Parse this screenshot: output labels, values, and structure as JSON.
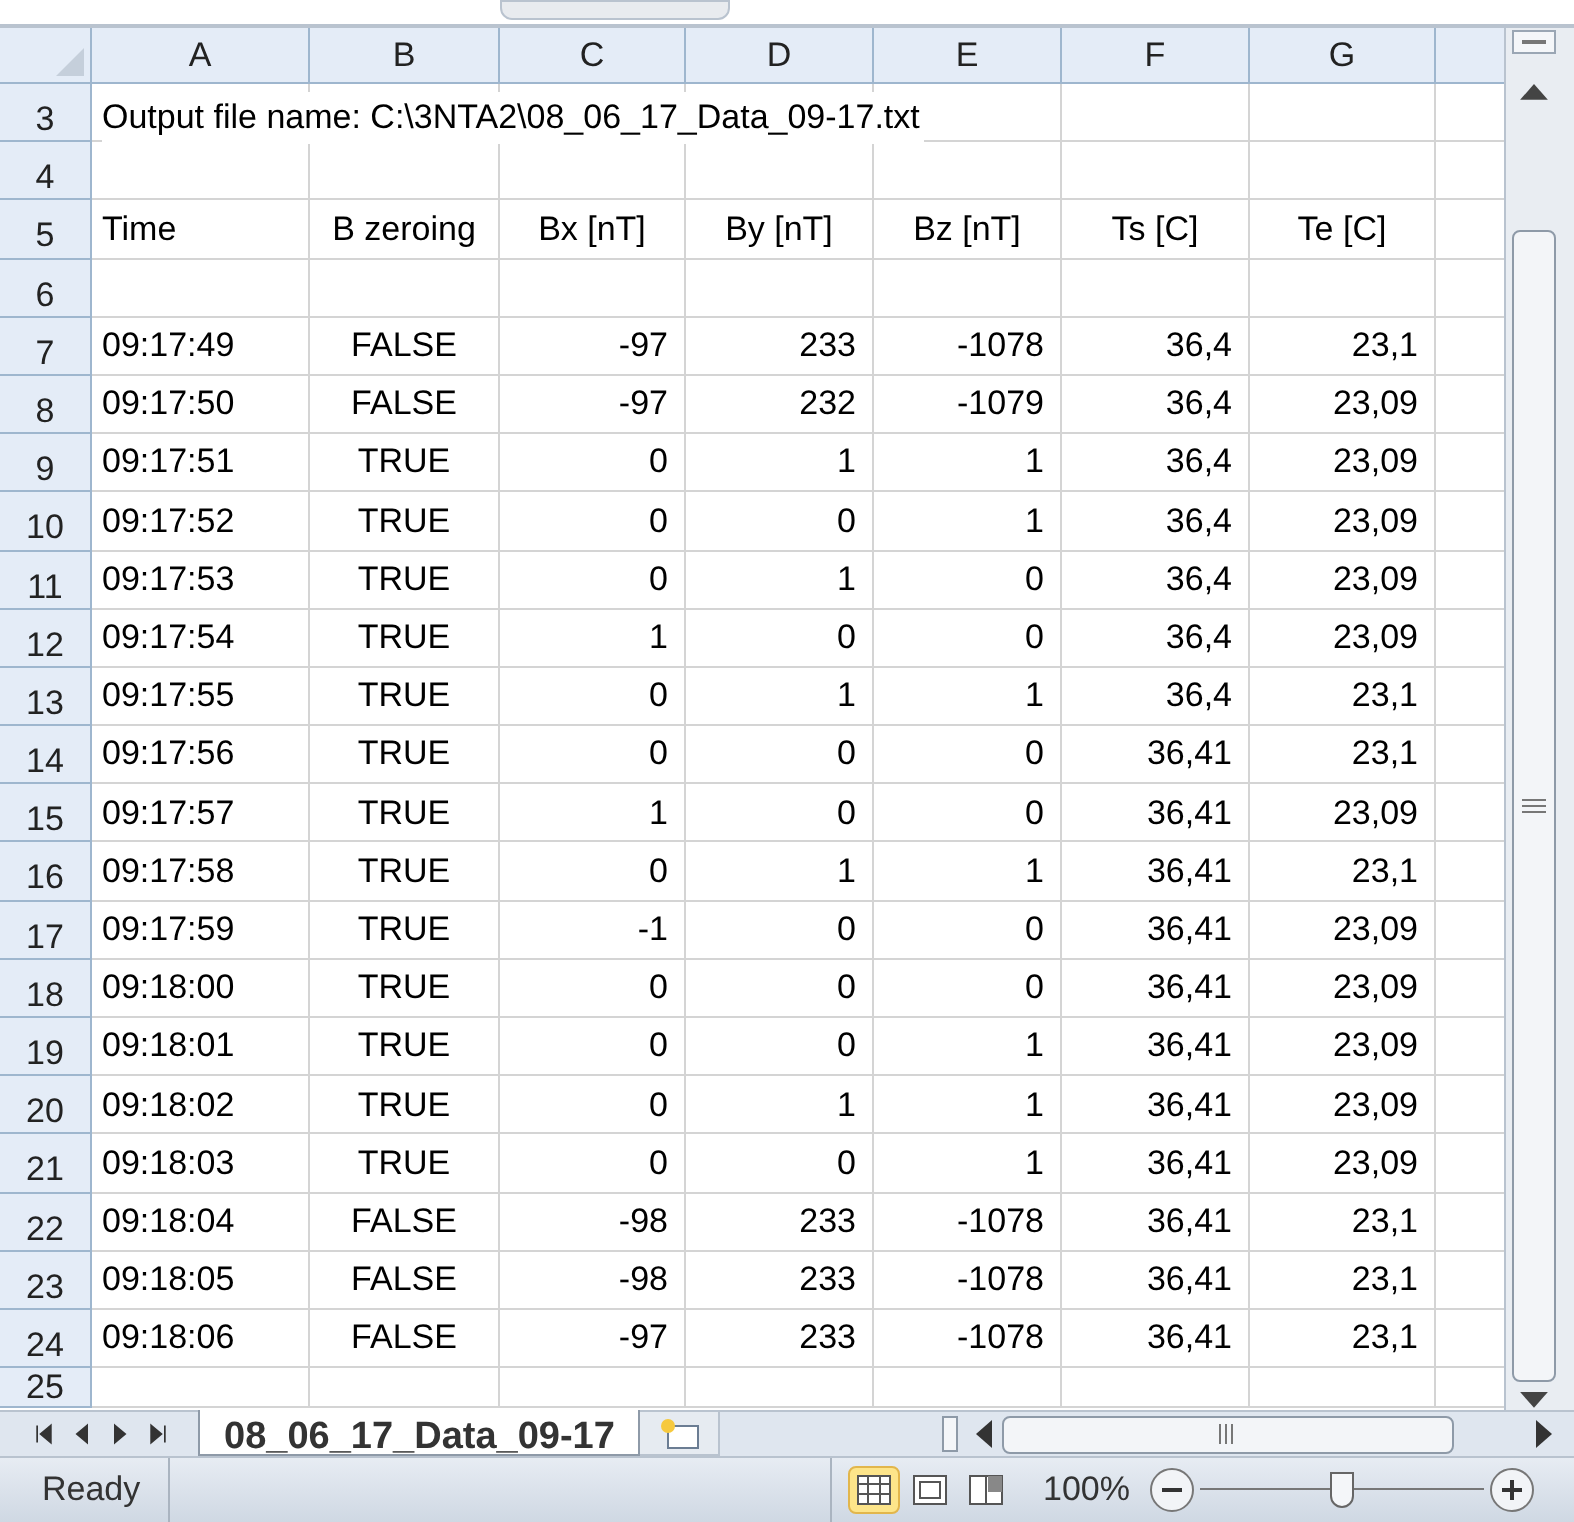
{
  "columns": [
    "A",
    "B",
    "C",
    "D",
    "E",
    "F",
    "G"
  ],
  "rows": [
    {
      "number": "3",
      "kind": "text",
      "text": "Output file name: C:\\3NTA2\\08_06_17_Data_09-17.txt"
    },
    {
      "number": "4",
      "kind": "blank"
    },
    {
      "number": "5",
      "kind": "header",
      "cells": [
        "Time",
        "B zeroing",
        "Bx [nT]",
        "By [nT]",
        "Bz [nT]",
        "Ts [C]",
        "Te [C]"
      ]
    },
    {
      "number": "6",
      "kind": "blank"
    },
    {
      "number": "7",
      "kind": "data",
      "cells": [
        "09:17:49",
        "FALSE",
        "-97",
        "233",
        "-1078",
        "36,4",
        "23,1"
      ]
    },
    {
      "number": "8",
      "kind": "data",
      "cells": [
        "09:17:50",
        "FALSE",
        "-97",
        "232",
        "-1079",
        "36,4",
        "23,09"
      ]
    },
    {
      "number": "9",
      "kind": "data",
      "cells": [
        "09:17:51",
        "TRUE",
        "0",
        "1",
        "1",
        "36,4",
        "23,09"
      ]
    },
    {
      "number": "10",
      "kind": "data",
      "cells": [
        "09:17:52",
        "TRUE",
        "0",
        "0",
        "1",
        "36,4",
        "23,09"
      ]
    },
    {
      "number": "11",
      "kind": "data",
      "cells": [
        "09:17:53",
        "TRUE",
        "0",
        "1",
        "0",
        "36,4",
        "23,09"
      ]
    },
    {
      "number": "12",
      "kind": "data",
      "cells": [
        "09:17:54",
        "TRUE",
        "1",
        "0",
        "0",
        "36,4",
        "23,09"
      ]
    },
    {
      "number": "13",
      "kind": "data",
      "cells": [
        "09:17:55",
        "TRUE",
        "0",
        "1",
        "1",
        "36,4",
        "23,1"
      ]
    },
    {
      "number": "14",
      "kind": "data",
      "cells": [
        "09:17:56",
        "TRUE",
        "0",
        "0",
        "0",
        "36,41",
        "23,1"
      ]
    },
    {
      "number": "15",
      "kind": "data",
      "cells": [
        "09:17:57",
        "TRUE",
        "1",
        "0",
        "0",
        "36,41",
        "23,09"
      ]
    },
    {
      "number": "16",
      "kind": "data",
      "cells": [
        "09:17:58",
        "TRUE",
        "0",
        "1",
        "1",
        "36,41",
        "23,1"
      ]
    },
    {
      "number": "17",
      "kind": "data",
      "cells": [
        "09:17:59",
        "TRUE",
        "-1",
        "0",
        "0",
        "36,41",
        "23,09"
      ]
    },
    {
      "number": "18",
      "kind": "data",
      "cells": [
        "09:18:00",
        "TRUE",
        "0",
        "0",
        "0",
        "36,41",
        "23,09"
      ]
    },
    {
      "number": "19",
      "kind": "data",
      "cells": [
        "09:18:01",
        "TRUE",
        "0",
        "0",
        "1",
        "36,41",
        "23,09"
      ]
    },
    {
      "number": "20",
      "kind": "data",
      "cells": [
        "09:18:02",
        "TRUE",
        "0",
        "1",
        "1",
        "36,41",
        "23,09"
      ]
    },
    {
      "number": "21",
      "kind": "data",
      "cells": [
        "09:18:03",
        "TRUE",
        "0",
        "0",
        "1",
        "36,41",
        "23,09"
      ]
    },
    {
      "number": "22",
      "kind": "data",
      "cells": [
        "09:18:04",
        "FALSE",
        "-98",
        "233",
        "-1078",
        "36,41",
        "23,1"
      ]
    },
    {
      "number": "23",
      "kind": "data",
      "cells": [
        "09:18:05",
        "FALSE",
        "-98",
        "233",
        "-1078",
        "36,41",
        "23,1"
      ]
    },
    {
      "number": "24",
      "kind": "data",
      "cells": [
        "09:18:06",
        "FALSE",
        "-97",
        "233",
        "-1078",
        "36,41",
        "23,1"
      ]
    },
    {
      "number": "25",
      "kind": "partial"
    }
  ],
  "sheet_tabs": [
    {
      "label": "08_06_17_Data_09-17",
      "selected": true
    }
  ],
  "status_bar": {
    "status": "Ready",
    "views": [
      {
        "kind": "normal",
        "selected": true
      },
      {
        "kind": "layout",
        "selected": false
      },
      {
        "kind": "break",
        "selected": false
      }
    ],
    "zoom": "100%",
    "zoom_slider": {
      "level": 0.5
    }
  }
}
